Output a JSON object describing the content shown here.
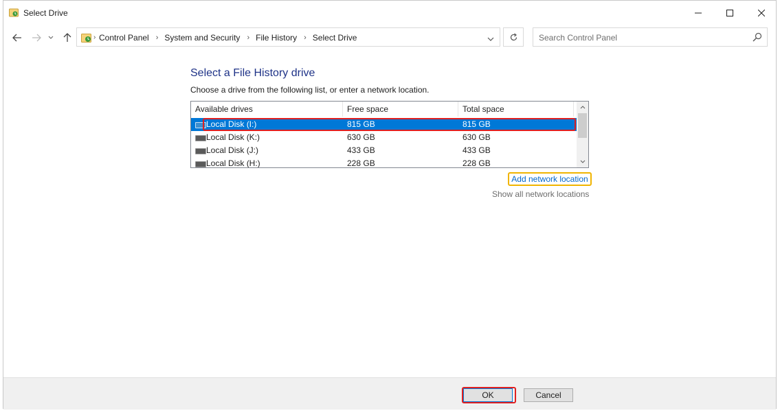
{
  "window": {
    "title": "Select Drive",
    "controls": {
      "minimize": "minimize-icon",
      "maximize": "maximize-icon",
      "close": "close-icon"
    }
  },
  "address": {
    "breadcrumbs": [
      "Control Panel",
      "System and Security",
      "File History",
      "Select Drive"
    ]
  },
  "search": {
    "placeholder": "Search Control Panel"
  },
  "content": {
    "heading": "Select a File History drive",
    "instructions": "Choose a drive from the following list, or enter a network location."
  },
  "drive_list": {
    "columns": [
      "Available drives",
      "Free space",
      "Total space"
    ],
    "rows": [
      {
        "name": "Local Disk (I:)",
        "free": "815 GB",
        "total": "815 GB",
        "selected": true
      },
      {
        "name": "Local Disk (K:)",
        "free": "630 GB",
        "total": "630 GB",
        "selected": false
      },
      {
        "name": "Local Disk (J:)",
        "free": "433 GB",
        "total": "433 GB",
        "selected": false
      },
      {
        "name": "Local Disk (H:)",
        "free": "228 GB",
        "total": "228 GB",
        "selected": false
      }
    ]
  },
  "links": {
    "add_network": "Add network location",
    "show_all_network": "Show all network locations"
  },
  "buttons": {
    "ok": "OK",
    "cancel": "Cancel"
  },
  "colors": {
    "selection": "#0078d7",
    "heading": "#1e3287",
    "link": "#0066cc",
    "highlight_red": "#e02020",
    "highlight_yellow": "#f0b400"
  }
}
